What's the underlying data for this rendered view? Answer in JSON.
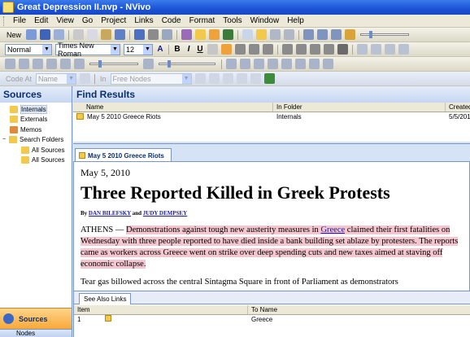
{
  "window": {
    "title": "Great Depression II.nvp - NVivo"
  },
  "menu": [
    "File",
    "Edit",
    "View",
    "Go",
    "Project",
    "Links",
    "Code",
    "Format",
    "Tools",
    "Window",
    "Help"
  ],
  "toolbar": {
    "new_label": "New",
    "style_value": "Normal",
    "font_value": "Times New Roman",
    "size_value": "12",
    "code_at_label": "Code At",
    "code_at_field": "Name",
    "in_label": "In",
    "in_field": "Free Nodes"
  },
  "sources_pane": {
    "title": "Sources",
    "tree": [
      {
        "label": "Internals",
        "icon": "folder-icon",
        "selected": true
      },
      {
        "label": "Externals",
        "icon": "folder-icon"
      },
      {
        "label": "Memos",
        "icon": "memo-icon"
      },
      {
        "label": "Search Folders",
        "icon": "search-folder-icon"
      },
      {
        "label": "All Sources",
        "icon": "folder-icon"
      },
      {
        "label": "All Sources",
        "icon": "folder-icon"
      }
    ],
    "nav_sources": "Sources",
    "nav_nodes": "Nodes"
  },
  "find_results": {
    "title": "Find Results",
    "columns": [
      "Name",
      "In Folder",
      "Created"
    ],
    "rows": [
      {
        "name": "May 5 2010 Greece Riots",
        "folder": "Internals",
        "created": "5/5/201"
      }
    ]
  },
  "detail": {
    "tab_label": "May 5 2010 Greece Riots",
    "date": "May 5, 2010",
    "headline": "Three Reported Killed in Greek Protests",
    "byline_prefix": "By ",
    "author1": "DAN BILEFSKY",
    "byline_and": " and ",
    "author2": "JUDY DEMPSEY",
    "para1_lead": "ATHENS — ",
    "para1_hl_a": "Demonstrations against tough new austerity measures in ",
    "para1_link": "Greece",
    "para1_hl_b": " claimed their first fatalities on Wednesday with three people reported to have died inside a bank building set ablaze by protesters. The reports came as workers across Greece went on strike over deep spending cuts and new taxes aimed at staving off economic collapse.",
    "para2": "Tear gas billowed across the central Sintagma Square in front of Parliament as demonstrators"
  },
  "see_also": {
    "tab_label": "See Also Links",
    "columns": [
      "Item",
      "To Name"
    ],
    "rows": [
      {
        "item": "1",
        "to_name": "Greece"
      }
    ]
  },
  "colors": {
    "titlebar": "#1b53d6",
    "highlight": "#f4c6cf",
    "nav_active": "#f8a837",
    "link": "#1a1aa6"
  }
}
